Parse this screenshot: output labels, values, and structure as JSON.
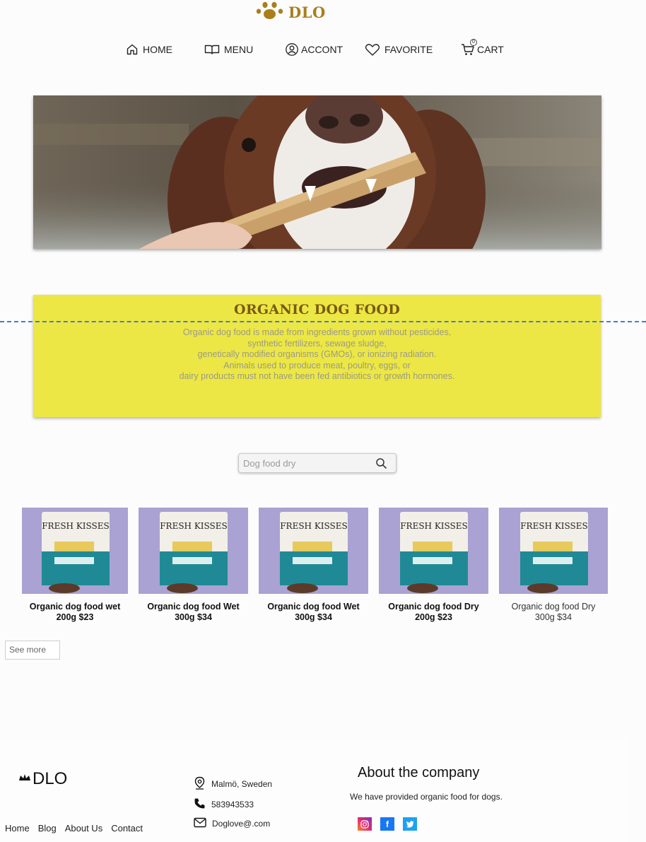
{
  "header": {
    "logo_text": "DLO",
    "logo_icon": "paw-icon",
    "nav": [
      {
        "label": "HOME",
        "icon": "home-icon"
      },
      {
        "label": "MENU",
        "icon": "book-icon"
      },
      {
        "label": "ACCONT",
        "icon": "user-circle-icon"
      },
      {
        "label": "FAVORITE",
        "icon": "heart-icon"
      },
      {
        "label": "CART",
        "icon": "cart-icon",
        "badge": "0"
      }
    ]
  },
  "organic": {
    "title": "ORGANIC DOG FOOD",
    "lines": [
      "Organic dog food is made from ingredients grown without pesticides,",
      "synthetic fertilizers, sewage sludge,",
      "genetically modified organisms (GMOs), or ionizing radiation.",
      "Animals used to produce meat, poultry, eggs, or",
      "dairy products must not have been fed antibiotics or growth hormones."
    ]
  },
  "search": {
    "placeholder": "Dog food dry"
  },
  "products": [
    {
      "line1": "Organic dog food wet",
      "line2": "200g $23",
      "package_text": "FRESH KISSES"
    },
    {
      "line1": "Organic dog food Wet",
      "line2": "300g $34",
      "package_text": "FRESH KISSES"
    },
    {
      "line1": "Organic dog food Wet",
      "line2": "300g $34",
      "package_text": "FRESH KISSES"
    },
    {
      "line1": "Organic dog food Dry",
      "line2": "200g $23",
      "package_text": "FRESH KISSES"
    },
    {
      "line1": "Organic dog food Dry",
      "line2": "300g $34",
      "package_text": "FRESH KISSES"
    }
  ],
  "see_more_label": "See more",
  "footer": {
    "logo_text": "DLO",
    "links": [
      "Home",
      "Blog",
      "About Us",
      "Contact"
    ],
    "location": "Malmö, Sweden",
    "phone": "583943533",
    "email": "Doglove@.com",
    "about_title": "About the company",
    "about_text": "We have provided organic food for dogs.",
    "social": [
      {
        "icon": "instagram-icon",
        "color": "#c13584"
      },
      {
        "icon": "facebook-icon",
        "color": "#1877f2"
      },
      {
        "icon": "twitter-icon",
        "color": "#1da1f2"
      }
    ]
  },
  "colors": {
    "accent": "#a97f1c",
    "banner": "#ece744",
    "banner_title": "#7a5a12",
    "dashed_line": "#3f7fd1"
  }
}
